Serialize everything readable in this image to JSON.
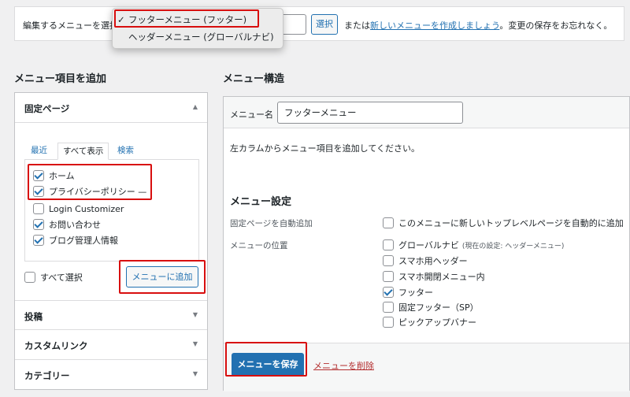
{
  "top_bar": {
    "label": "編集するメニューを選択",
    "select_button": "選択",
    "or_text": "または",
    "create_link": "新しいメニューを作成しましょう",
    "suffix": "。変更の保存をお忘れなく。"
  },
  "menu_dropdown": {
    "options": [
      "フッターメニュー (フッター)",
      "ヘッダーメニュー (グローバルナビ)"
    ],
    "selected": "フッターメニュー (フッター)",
    "check_glyph": "✓"
  },
  "left": {
    "heading": "メニュー項目を追加",
    "fixed_pages": {
      "title": "固定ページ",
      "tabs": [
        "最近",
        "すべて表示",
        "検索"
      ],
      "active_tab": "すべて表示",
      "items": [
        {
          "label": "ホーム",
          "checked": true
        },
        {
          "label": "プライバシーポリシー —",
          "checked": true
        },
        {
          "label": "Login Customizer",
          "checked": false
        },
        {
          "label": "お問い合わせ",
          "checked": true
        },
        {
          "label": "ブログ管理人情報",
          "checked": true
        }
      ],
      "select_all": "すべて選択",
      "add_button": "メニューに追加"
    },
    "sections": [
      "投稿",
      "カスタムリンク",
      "カテゴリー"
    ]
  },
  "right": {
    "heading": "メニュー構造",
    "name_label": "メニュー名",
    "name_value": "フッターメニュー",
    "instructions": "左カラムからメニュー項目を追加してください。",
    "settings_title": "メニュー設定",
    "auto_add_label": "固定ページを自動追加",
    "auto_add_option": "このメニューに新しいトップレベルページを自動的に追加",
    "location_label": "メニューの位置",
    "locations": [
      {
        "label": "グローバルナビ",
        "note": "(現在の設定: ヘッダーメニュー)",
        "checked": false
      },
      {
        "label": "スマホ用ヘッダー",
        "note": "",
        "checked": false
      },
      {
        "label": "スマホ開閉メニュー内",
        "note": "",
        "checked": false
      },
      {
        "label": "フッター",
        "note": "",
        "checked": true
      },
      {
        "label": "固定フッター（SP）",
        "note": "",
        "checked": false
      },
      {
        "label": "ピックアップバナー",
        "note": "",
        "checked": false
      }
    ],
    "save_button": "メニューを保存",
    "delete_link": "メニューを削除"
  },
  "colors": {
    "accent": "#2271b1",
    "highlight": "#d80e0e",
    "delete": "#b32d2e"
  }
}
